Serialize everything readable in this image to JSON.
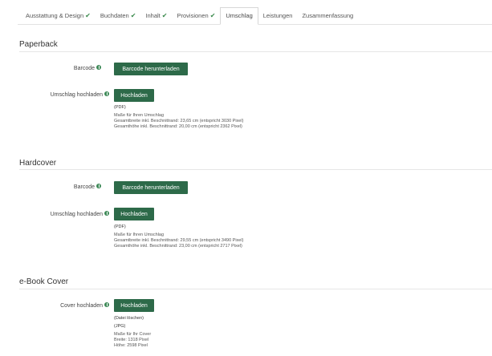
{
  "tabs": [
    {
      "label": "Ausstattung & Design",
      "done": true,
      "active": false
    },
    {
      "label": "Buchdaten",
      "done": true,
      "active": false
    },
    {
      "label": "Inhalt",
      "done": true,
      "active": false
    },
    {
      "label": "Provisionen",
      "done": true,
      "active": false
    },
    {
      "label": "Umschlag",
      "done": false,
      "active": true
    },
    {
      "label": "Leistungen",
      "done": false,
      "active": false
    },
    {
      "label": "Zusammenfassung",
      "done": false,
      "active": false
    }
  ],
  "check_glyph": "✔",
  "paperback": {
    "title": "Paperback",
    "barcode_label": "Barcode",
    "barcode_button": "Barcode herunterladen",
    "upload_label": "Umschlag hochladen",
    "upload_button": "Hochladen",
    "format": "(PDF)",
    "dims_title": "Maße für Ihren Umschlag",
    "width_line": "Gesamtbreite inkl. Beschnittrand: 23,65 cm (entspricht 3030 Pixel)",
    "height_line": "Gesamthöhe inkl. Beschnittrand: 20,00 cm (entspricht 2362 Pixel)"
  },
  "hardcover": {
    "title": "Hardcover",
    "barcode_label": "Barcode",
    "barcode_button": "Barcode herunterladen",
    "upload_label": "Umschlag hochladen",
    "upload_button": "Hochladen",
    "format": "(PDF)",
    "dims_title": "Maße für Ihren Umschlag",
    "width_line": "Gesamtbreite inkl. Beschnittrand: 29,55 cm (entspricht 3490 Pixel)",
    "height_line": "Gesamthöhe inkl. Beschnittrand: 23,00 cm (entspricht 2717 Pixel)"
  },
  "ebook": {
    "title": "e-Book Cover",
    "upload_label": "Cover hochladen",
    "upload_button": "Hochladen",
    "delete_link": "(Datei löschen)",
    "format": "(JPG)",
    "dims_title": "Maße für Ihr Cover",
    "width_line": "Breite: 1318 Pixel",
    "height_line": "Höhe: 2598 Pixel"
  }
}
